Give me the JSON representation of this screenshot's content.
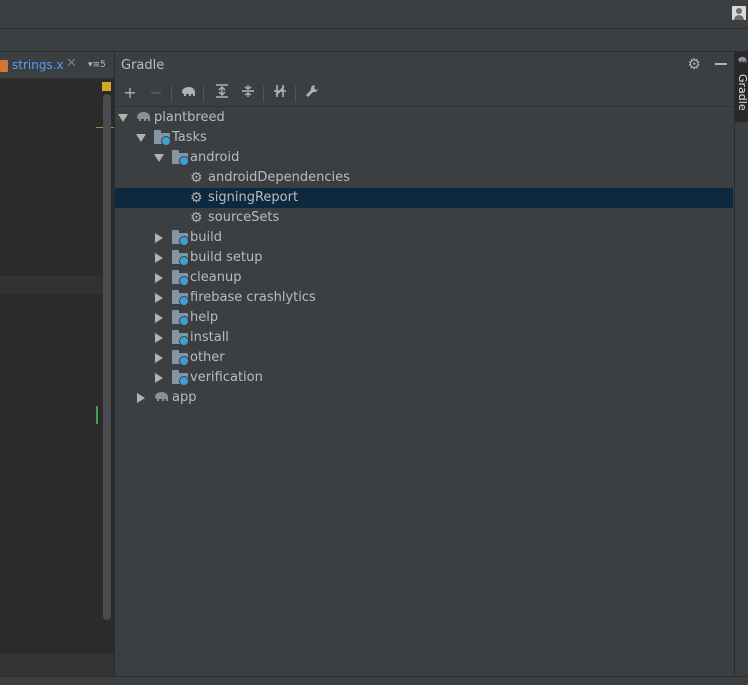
{
  "editor": {
    "tab_label": "strings.x",
    "tab_close": "✕",
    "tab_menu": "▾≡5"
  },
  "gradle": {
    "title": "Gradle",
    "toolbar": {
      "add": "+",
      "remove": "−"
    },
    "tree": {
      "root": "plantbreed",
      "tasks": "Tasks",
      "android": "android",
      "android_dependencies": "androidDependencies",
      "signing_report": "signingReport",
      "source_sets": "sourceSets",
      "build": "build",
      "build_setup": "build setup",
      "cleanup": "cleanup",
      "firebase_crashlytics": "firebase crashlytics",
      "help": "help",
      "install": "install",
      "other": "other",
      "verification": "verification",
      "app": "app"
    }
  },
  "side_tab": {
    "label": "Gradle"
  },
  "colors": {
    "background": "#3c3f41",
    "editor_bg": "#2b2b2b",
    "selection": "#0d293e",
    "tab_link": "#589df6",
    "folder_badge": "#3d9fd6"
  }
}
